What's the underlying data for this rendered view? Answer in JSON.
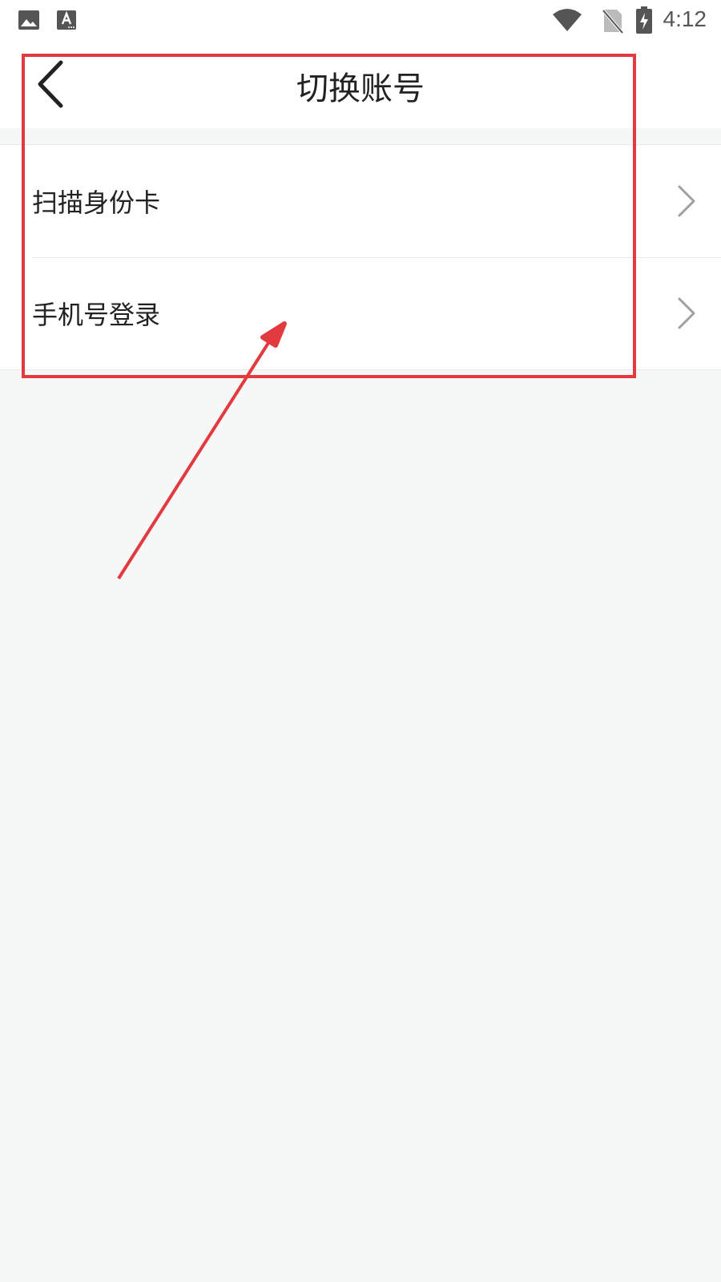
{
  "status_bar": {
    "time": "4:12",
    "left_icons": [
      "image-icon",
      "keyboard-a-icon"
    ],
    "right_icons": [
      "wifi-icon",
      "no-sim-icon",
      "battery-charging-icon"
    ]
  },
  "nav": {
    "title": "切换账号",
    "back_icon": "chevron-left-icon"
  },
  "list": {
    "items": [
      {
        "label": "扫描身份卡",
        "icon": "chevron-right-icon"
      },
      {
        "label": "手机号登录",
        "icon": "chevron-right-icon"
      }
    ]
  },
  "colors": {
    "annotation": "#e23a3f",
    "page_background": "#f6f7f7",
    "surface": "#ffffff",
    "divider": "#e8e8e8",
    "text": "#222222",
    "chevron": "#a0a0a0",
    "status_icon": "#555555"
  }
}
